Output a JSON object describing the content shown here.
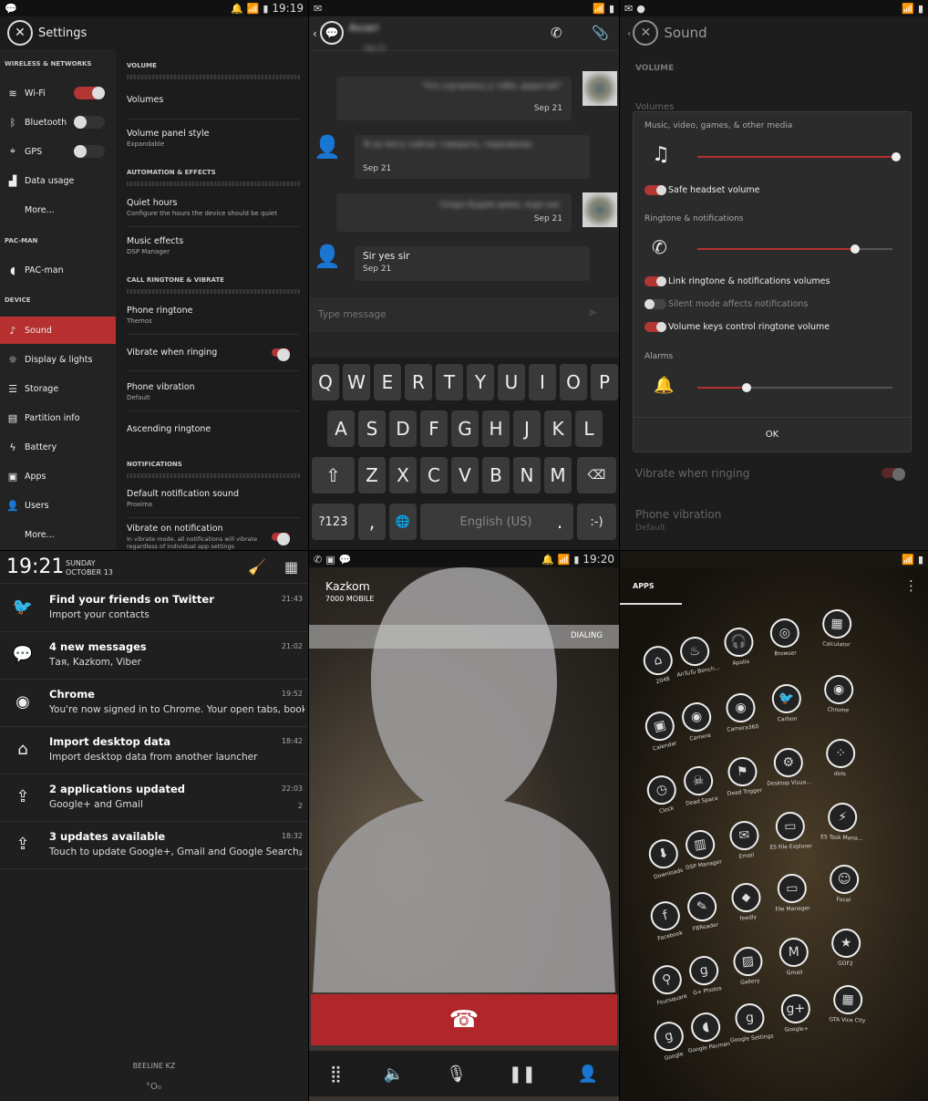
{
  "settings": {
    "status_time": "19:19",
    "title": "Settings",
    "nav": {
      "h1": "WIRELESS & NETWORKS",
      "wifi": "Wi-Fi",
      "bluetooth": "Bluetooth",
      "gps": "GPS",
      "data": "Data usage",
      "more1": "More...",
      "h2": "PAC-MAN",
      "pacman": "PAC-man",
      "h3": "DEVICE",
      "sound": "Sound",
      "display": "Display & lights",
      "storage": "Storage",
      "partition": "Partition info",
      "battery": "Battery",
      "apps": "Apps",
      "users": "Users",
      "more2": "More..."
    },
    "list": {
      "h_volume": "VOLUME",
      "volumes": "Volumes",
      "panel_style": "Volume panel style",
      "panel_style_sub": "Expandable",
      "h_auto": "AUTOMATION & EFFECTS",
      "quiet": "Quiet hours",
      "quiet_sub": "Configure the hours the device should be quiet",
      "music": "Music effects",
      "music_sub": "DSP Manager",
      "h_call": "CALL RINGTONE & VIBRATE",
      "ringtone": "Phone ringtone",
      "ringtone_sub": "Themos",
      "vibrate_ring": "Vibrate when ringing",
      "vibration": "Phone vibration",
      "vibration_sub": "Default",
      "ascending": "Ascending ringtone",
      "h_notif": "NOTIFICATIONS",
      "def_sound": "Default notification sound",
      "def_sound_sub": "Proxima",
      "vib_notif": "Vibrate on notification",
      "vib_notif_sub": "In vibrate mode, all notifications will vibrate regardless of individual app settings"
    }
  },
  "messaging": {
    "contact": "Анзат",
    "top_date": "Sep 21",
    "m1_text": "Что случилось у тебя, дорогой?",
    "m1_date": "Sep 21",
    "m2_text": "Я не могу сейчас говорить, перезвоню",
    "m2_date": "Sep 21",
    "m3_text": "Скоро будем дома, жди нас",
    "m3_date": "Sep 21",
    "m4_text": "Sir yes sir",
    "m4_date": "Sep 21",
    "placeholder": "Type message",
    "row1": [
      "Q",
      "W",
      "E",
      "R",
      "T",
      "Y",
      "U",
      "I",
      "O",
      "P"
    ],
    "row2": [
      "A",
      "S",
      "D",
      "F",
      "G",
      "H",
      "J",
      "K",
      "L"
    ],
    "row3": [
      "Z",
      "X",
      "C",
      "V",
      "B",
      "N",
      "M"
    ],
    "sym": "?123",
    "comma": ",",
    "space": "English (US)",
    "period": ".",
    "smiley": ":-)"
  },
  "sound": {
    "title": "Sound",
    "h_volume": "VOLUME",
    "behind_volumes": "Volumes",
    "media_label": "Music, video, games, & other media",
    "media_level": 0.98,
    "safe_headset": "Safe headset volume",
    "ring_label": "Ringtone & notifications",
    "ring_level": 0.81,
    "link": "Link ringtone & notifications volumes",
    "silent": "Silent mode affects notifications",
    "vol_keys": "Volume keys control ringtone volume",
    "alarm_label": "Alarms",
    "alarm_level": 0.25,
    "ok": "OK",
    "behind_vibrate": "Vibrate when ringing",
    "behind_vibration": "Phone vibration",
    "behind_vibration_sub": "Default"
  },
  "notifications": {
    "time": "19:21",
    "day": "SUNDAY",
    "date": "OCTOBER 13",
    "items": [
      {
        "title": "Find your friends on Twitter",
        "sub": "Import your contacts",
        "time": "21:43",
        "count": ""
      },
      {
        "title": "4 new messages",
        "sub": "Тая, Kazkom, Viber",
        "time": "21:02",
        "count": ""
      },
      {
        "title": "Chrome",
        "sub": "You're now signed in to Chrome. Your open tabs, bookmarks",
        "time": "19:52",
        "count": ""
      },
      {
        "title": "Import desktop data",
        "sub": "Import desktop data from another launcher",
        "time": "18:42",
        "count": ""
      },
      {
        "title": "2 applications updated",
        "sub": "Google+ and Gmail",
        "time": "22:03",
        "count": "2"
      },
      {
        "title": "3 updates available",
        "sub": "Touch to update Google+, Gmail and Google Search.",
        "time": "18:32",
        "count": "3"
      }
    ],
    "carrier": "BEELINE KZ"
  },
  "dialer": {
    "status_time": "19:20",
    "name": "Kazkom",
    "number": "7000",
    "type": "MOBILE",
    "state": "DIALING"
  },
  "apps": {
    "tab": "APPS",
    "items": [
      "2048",
      "AnTuTu Bench...",
      "Apollo",
      "Browser",
      "Calculator",
      "Calendar",
      "Camera",
      "Camera360",
      "Carbon",
      "Chrome",
      "Clock",
      "Dead Space",
      "Dead Trigger",
      "Desktop Visua...",
      "dots",
      "Downloads",
      "DSP Manager",
      "Email",
      "ES File Explorer",
      "ES Task Mana...",
      "Facebook",
      "FBReader",
      "feedly",
      "File Manager",
      "Focal",
      "Foursquare",
      "G+ Photos",
      "Gallery",
      "Gmail",
      "GOF2",
      "Google",
      "Google Pacman",
      "Google Settings",
      "Google+",
      "GTA Vice City"
    ]
  }
}
